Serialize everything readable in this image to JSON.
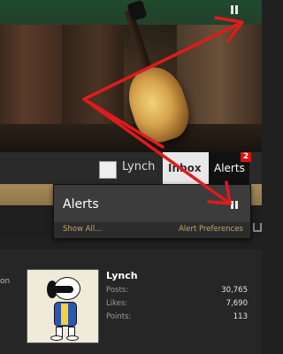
{
  "nav": {
    "username": "Lynch",
    "inbox_label": "Inbox",
    "alerts_label": "Alerts",
    "alerts_count": "2"
  },
  "alerts_popup": {
    "title": "Alerts",
    "show_all": "Show All...",
    "preferences": "Alert Preferences"
  },
  "left_fragment": "on",
  "profile": {
    "name": "Lynch",
    "stats": [
      {
        "label": "Posts:",
        "value": "30,765"
      },
      {
        "label": "Likes:",
        "value": "7,690"
      },
      {
        "label": "Points:",
        "value": "113"
      }
    ]
  },
  "colors": {
    "arrow": "#e01b1b",
    "badge": "#dd1111",
    "link": "#c6a36a",
    "gold_strip": "#a88b58"
  },
  "icons": {
    "banner_button": "pause-icon",
    "popup_toggle": "pause-icon"
  }
}
